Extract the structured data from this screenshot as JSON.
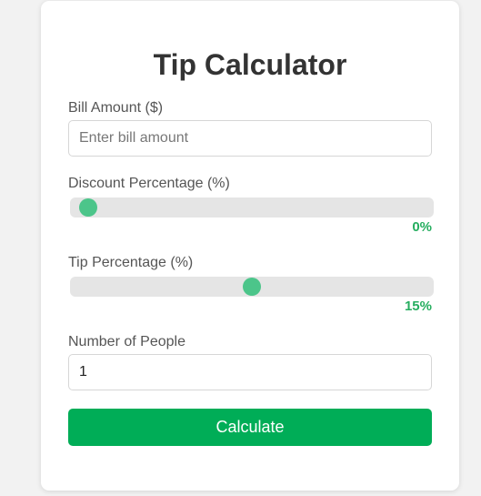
{
  "title": "Tip Calculator",
  "bill": {
    "label": "Bill Amount ($)",
    "placeholder": "Enter bill amount",
    "value": ""
  },
  "discount": {
    "label": "Discount Percentage (%)",
    "value": 0,
    "min": 0,
    "max": 100,
    "value_text": "0%"
  },
  "tip": {
    "label": "Tip Percentage (%)",
    "value": 15,
    "min": 0,
    "max": 30,
    "value_text": "15%"
  },
  "people": {
    "label": "Number of People",
    "value": "1"
  },
  "button": {
    "label": "Calculate"
  },
  "colors": {
    "accent": "#00ad57",
    "thumb": "#4cc58a",
    "value_text": "#27ae60",
    "track": "#e5e5e5"
  }
}
